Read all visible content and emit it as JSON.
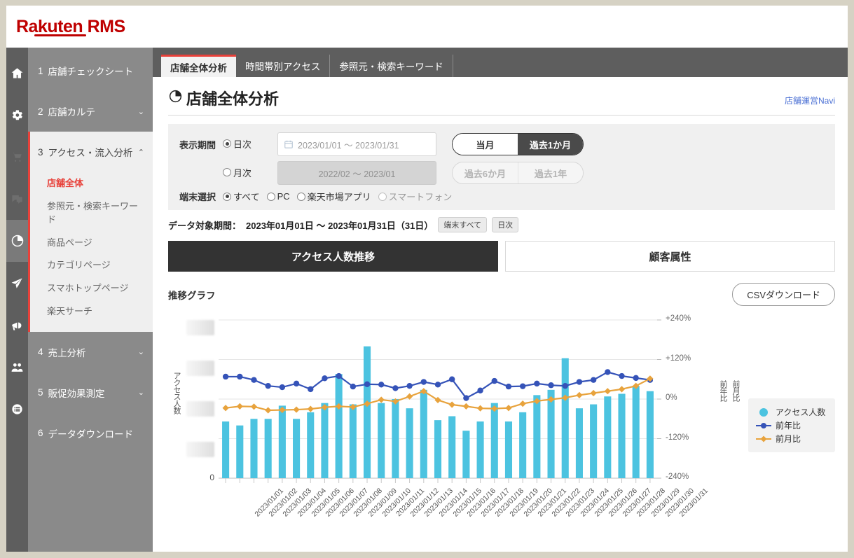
{
  "brand": {
    "name_a": "Ra",
    "name_b": "kuten RMS",
    "full": "Rakuten RMS"
  },
  "icon_rail": [
    {
      "name": "home-icon",
      "state": "normal"
    },
    {
      "name": "gear-icon",
      "state": "normal"
    },
    {
      "name": "cart-icon",
      "state": "dim"
    },
    {
      "name": "chat-icon",
      "state": "dim"
    },
    {
      "name": "pie-chart-icon",
      "state": "active"
    },
    {
      "name": "paper-plane-icon",
      "state": "normal"
    },
    {
      "name": "megaphone-icon",
      "state": "normal"
    },
    {
      "name": "people-icon",
      "state": "normal"
    },
    {
      "name": "list-icon",
      "state": "normal"
    }
  ],
  "sidebar": {
    "items": [
      {
        "num": "1",
        "label": "店舗チェックシート",
        "chevron": ""
      },
      {
        "num": "2",
        "label": "店舗カルテ",
        "chevron": "⌄"
      },
      {
        "num": "3",
        "label": "アクセス・流入分析",
        "chevron": "⌃"
      },
      {
        "num": "4",
        "label": "売上分析",
        "chevron": "⌄"
      },
      {
        "num": "5",
        "label": "販促効果測定",
        "chevron": "⌄"
      },
      {
        "num": "6",
        "label": "データダウンロード",
        "chevron": ""
      }
    ],
    "sub_items": [
      "店舗全体",
      "参照元・検索キーワード",
      "商品ページ",
      "カテゴリページ",
      "スマホトップページ",
      "楽天サーチ"
    ],
    "selected_sub": "店舗全体"
  },
  "tabs": [
    {
      "label": "店舗全体分析",
      "active": true
    },
    {
      "label": "時間帯別アクセス",
      "active": false
    },
    {
      "label": "参照元・検索キーワード",
      "active": false
    }
  ],
  "header": {
    "title": "店舗全体分析",
    "title_icon": "pie-chart-icon",
    "navi_link": "店舗運営Navi"
  },
  "filters": {
    "period_label": "表示期間",
    "daily_radio": "日次",
    "monthly_radio": "月次",
    "daily_value": "2023/01/01 ～ 2023/01/31",
    "monthly_value": "2022/02 ～ 2023/01",
    "device_label": "端末選択",
    "devices": [
      {
        "label": "すべて",
        "selected": true,
        "muted": false
      },
      {
        "label": "PC",
        "selected": false,
        "muted": false
      },
      {
        "label": "楽天市場アプリ",
        "selected": false,
        "muted": false
      },
      {
        "label": "スマートフォン",
        "selected": false,
        "muted": true
      }
    ],
    "range_top": [
      {
        "label": "当月",
        "on": false
      },
      {
        "label": "過去1か月",
        "on": true
      }
    ],
    "range_bottom": [
      {
        "label": "過去6か月",
        "on": false
      },
      {
        "label": "過去1年",
        "on": false
      }
    ]
  },
  "period_line": {
    "prefix": "データ対象期間：",
    "value": "2023年01月01日 ～ 2023年01月31日（31日）",
    "chips": [
      "端末すべて",
      "日次"
    ]
  },
  "big_tabs": [
    {
      "label": "アクセス人数推移",
      "active": true
    },
    {
      "label": "顧客属性",
      "active": false
    }
  ],
  "chart_panel": {
    "title": "推移グラフ",
    "csv_button": "CSVダウンロード"
  },
  "colors": {
    "brand_red": "#bf0000",
    "accent_red": "#e8413a",
    "bar_cyan": "#4cc3e0",
    "line_blue": "#3553b8",
    "line_orange": "#e8a33d",
    "sidebar_gray": "#8a8a8a",
    "rail_gray": "#5e5e5e",
    "panel_dark": "#333333"
  },
  "chart_data": {
    "type": "bar",
    "title": "推移グラフ",
    "xlabel": "",
    "ylabel": "アクセス人数",
    "y2label_1": "前年比",
    "y2label_2": "前月比",
    "grid": true,
    "legend_position": "right",
    "y_left_ticks": [
      "",
      "",
      "",
      "",
      "0"
    ],
    "y_left_ticks_redacted": true,
    "y_right_ticks": [
      "+240%",
      "+120%",
      "0%",
      "-120%",
      "-240%"
    ],
    "y2lim": [
      -240,
      240
    ],
    "categories": [
      "2023/01/01",
      "2023/01/02",
      "2023/01/03",
      "2023/01/04",
      "2023/01/05",
      "2023/01/06",
      "2023/01/07",
      "2023/01/08",
      "2023/01/09",
      "2023/01/10",
      "2023/01/11",
      "2023/01/12",
      "2023/01/13",
      "2023/01/14",
      "2023/01/15",
      "2023/01/16",
      "2023/01/17",
      "2023/01/18",
      "2023/01/19",
      "2023/01/20",
      "2023/01/21",
      "2023/01/22",
      "2023/01/23",
      "2023/01/24",
      "2023/01/25",
      "2023/01/26",
      "2023/01/27",
      "2023/01/28",
      "2023/01/29",
      "2023/01/30",
      "2023/01/31"
    ],
    "series": [
      {
        "name": "アクセス人数",
        "type": "bar",
        "color": "#4cc3e0",
        "axis": "left",
        "values": [
          43,
          40,
          45,
          45,
          55,
          45,
          50,
          57,
          79,
          56,
          100,
          57,
          60,
          53,
          67,
          44,
          47,
          36,
          43,
          57,
          43,
          50,
          63,
          67,
          91,
          53,
          56,
          62,
          64,
          70,
          66
        ]
      },
      {
        "name": "前年比",
        "type": "line",
        "color": "#3553b8",
        "axis": "right",
        "values": [
          68,
          68,
          58,
          40,
          36,
          47,
          30,
          63,
          70,
          38,
          45,
          44,
          33,
          40,
          52,
          44,
          60,
          3,
          26,
          55,
          38,
          39,
          47,
          42,
          40,
          52,
          58,
          82,
          70,
          64,
          58
        ]
      },
      {
        "name": "前月比",
        "type": "line",
        "color": "#e8a33d",
        "axis": "right",
        "values": [
          -27,
          -22,
          -23,
          -34,
          -33,
          -32,
          -30,
          -25,
          -22,
          -24,
          -14,
          -2,
          -7,
          8,
          24,
          -3,
          -17,
          -22,
          -28,
          -29,
          -27,
          -14,
          -6,
          -1,
          4,
          12,
          18,
          24,
          30,
          40,
          62
        ]
      }
    ]
  }
}
